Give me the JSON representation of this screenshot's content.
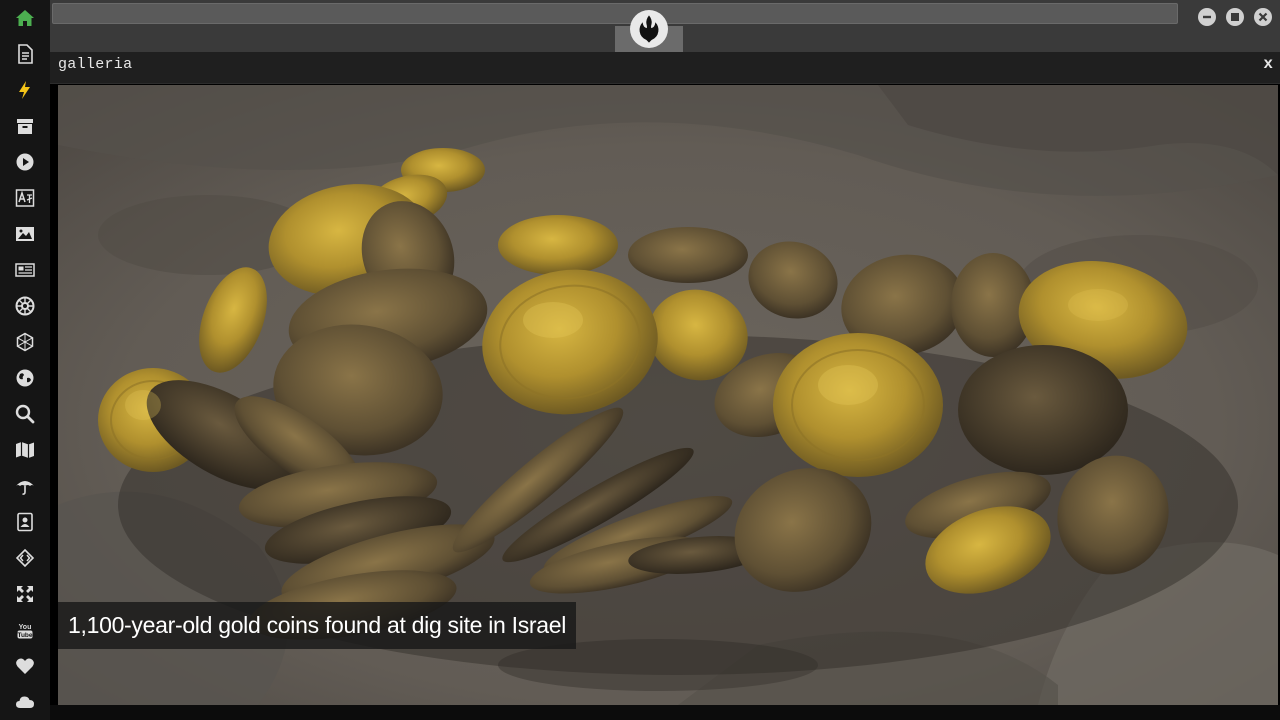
{
  "sidebar": {
    "items": [
      {
        "icon": "home-icon",
        "color": "#4caf50"
      },
      {
        "icon": "document-icon"
      },
      {
        "icon": "lightning-icon",
        "color": "#f5c518"
      },
      {
        "icon": "archive-icon"
      },
      {
        "icon": "play-icon"
      },
      {
        "icon": "translate-icon"
      },
      {
        "icon": "image-icon"
      },
      {
        "icon": "newspaper-icon"
      },
      {
        "icon": "empire-icon"
      },
      {
        "icon": "hexagon-network-icon"
      },
      {
        "icon": "globe-icon"
      },
      {
        "icon": "search-icon"
      },
      {
        "icon": "map-icon"
      },
      {
        "icon": "umbrella-icon"
      },
      {
        "icon": "contact-book-icon"
      },
      {
        "icon": "code-diamond-icon"
      },
      {
        "icon": "expand-icon"
      },
      {
        "icon": "youtube-icon"
      },
      {
        "icon": "heart-icon"
      },
      {
        "icon": "cloud-icon"
      }
    ]
  },
  "window": {
    "title": "galleria",
    "close_label": "x"
  },
  "gallery": {
    "caption": "1,100-year-old gold coins found at dig site in Israel"
  },
  "colors": {
    "sidebar_bg": "#151515",
    "topbar_bg": "#3a3a3a",
    "accent_green": "#4caf50"
  }
}
